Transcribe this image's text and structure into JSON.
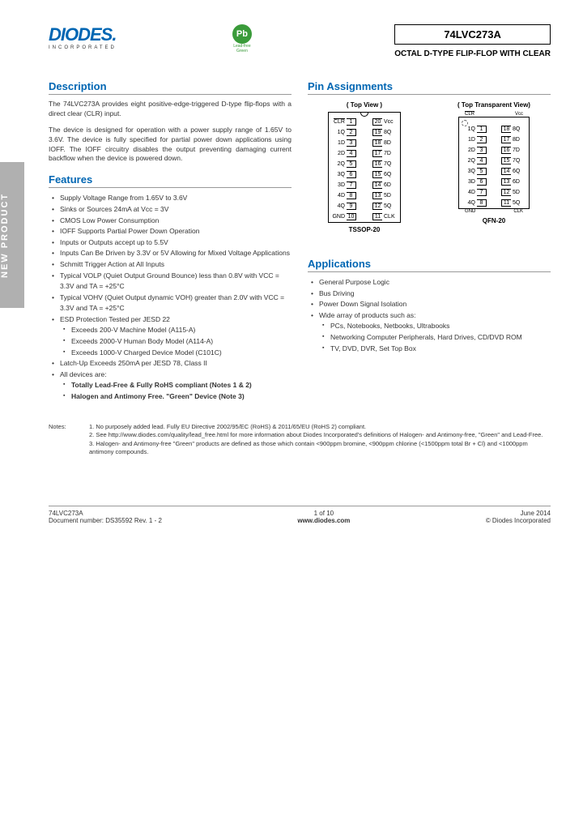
{
  "new_product_label": "NEW PRODUCT",
  "logo": "DIODES",
  "logo_sub": "INCORPORATED",
  "pb_symbol": "Pb",
  "pb_text": "Lead-free Green",
  "part_number": "74LVC273A",
  "subtitle": "OCTAL D-TYPE FLIP-FLOP WITH CLEAR",
  "sections": {
    "description": "Description",
    "features": "Features",
    "pin_assignments": "Pin Assignments",
    "applications": "Applications"
  },
  "description": {
    "p1": "The 74LVC273A provides eight positive-edge-triggered D-type flip-flops with a direct clear (CLR) input.",
    "p2": "The device is designed for operation with a power supply range of 1.65V to 3.6V. The device is fully specified for partial power down applications using IOFF. The IOFF circuitry disables the output preventing damaging current backflow when the device is powered down."
  },
  "features": [
    "Supply Voltage Range from 1.65V to 3.6V",
    "Sinks or Sources 24mA at Vcc = 3V",
    "CMOS Low Power Consumption",
    "IOFF Supports Partial Power Down Operation",
    "Inputs or Outputs accept up to 5.5V",
    "Inputs Can Be Driven by 3.3V or 5V Allowing for Mixed Voltage Applications",
    "Schmitt Trigger Action at All Inputs",
    "Typical VOLP (Quiet Output Ground Bounce) less than 0.8V with VCC = 3.3V and TA = +25°C",
    "Typical VOHV (Quiet Output dynamic VOH) greater than 2.0V with VCC = 3.3V and TA = +25°C",
    "ESD Protection Tested per JESD 22"
  ],
  "features_esd": [
    "Exceeds 200-V Machine Model (A115-A)",
    "Exceeds 2000-V Human Body Model (A114-A)",
    "Exceeds 1000-V Charged Device Model (C101C)"
  ],
  "features_after": [
    "Latch-Up Exceeds 250mA per JESD 78, Class II",
    "All devices are:"
  ],
  "features_compliance": [
    "Totally Lead-Free & Fully RoHS compliant (Notes 1 & 2)",
    "Halogen and Antimony Free. \"Green\" Device (Note 3)"
  ],
  "pin_labels": {
    "top_view": "( Top View )",
    "top_transparent": "( Top Transparent View)",
    "tssop": "TSSOP-20",
    "qfn": "QFN-20"
  },
  "pins_tssop": [
    {
      "l": "CLR",
      "nl": "1",
      "nr": "20",
      "r": "Vcc",
      "over_l": true
    },
    {
      "l": "1Q",
      "nl": "2",
      "nr": "19",
      "r": "8Q"
    },
    {
      "l": "1D",
      "nl": "3",
      "nr": "18",
      "r": "8D"
    },
    {
      "l": "2D",
      "nl": "4",
      "nr": "17",
      "r": "7D"
    },
    {
      "l": "2Q",
      "nl": "5",
      "nr": "16",
      "r": "7Q"
    },
    {
      "l": "3Q",
      "nl": "6",
      "nr": "15",
      "r": "6Q"
    },
    {
      "l": "3D",
      "nl": "7",
      "nr": "14",
      "r": "6D"
    },
    {
      "l": "4D",
      "nl": "8",
      "nr": "13",
      "r": "5D"
    },
    {
      "l": "4Q",
      "nl": "9",
      "nr": "12",
      "r": "5Q"
    },
    {
      "l": "GND",
      "nl": "10",
      "nr": "11",
      "r": "CLK"
    }
  ],
  "pins_qfn": [
    {
      "l": "1Q",
      "nl": "1",
      "nr": "18",
      "r": "8Q"
    },
    {
      "l": "1D",
      "nl": "2",
      "nr": "17",
      "r": "8D"
    },
    {
      "l": "2D",
      "nl": "3",
      "nr": "16",
      "r": "7D"
    },
    {
      "l": "2Q",
      "nl": "4",
      "nr": "15",
      "r": "7Q"
    },
    {
      "l": "3Q",
      "nl": "5",
      "nr": "14",
      "r": "6Q"
    },
    {
      "l": "3D",
      "nl": "6",
      "nr": "13",
      "r": "6D"
    },
    {
      "l": "4D",
      "nl": "7",
      "nr": "12",
      "r": "5D"
    },
    {
      "l": "4Q",
      "nl": "8",
      "nr": "11",
      "r": "5Q"
    }
  ],
  "qfn_top": {
    "l": "CLR",
    "r": "Vcc"
  },
  "qfn_bottom": {
    "l": "GND",
    "r": "CLK"
  },
  "applications": [
    "General Purpose Logic",
    "Bus Driving",
    "Power Down Signal Isolation",
    "Wide array of products such as:"
  ],
  "applications_sub": [
    "PCs, Notebooks, Netbooks, Ultrabooks",
    "Networking Computer Peripherals, Hard Drives, CD/DVD ROM",
    "TV, DVD, DVR, Set Top Box"
  ],
  "notes_label": "Notes:",
  "notes": [
    "1. No purposely added lead. Fully EU Directive 2002/95/EC (RoHS) & 2011/65/EU (RoHS 2) compliant.",
    "2. See http://www.diodes.com/quality/lead_free.html for more information about Diodes Incorporated's definitions of Halogen- and Antimony-free, \"Green\" and Lead-Free.",
    "3. Halogen- and Antimony-free \"Green\" products are defined as those which contain <900ppm bromine, <900ppm chlorine (<1500ppm total Br + Cl) and <1000ppm antimony compounds."
  ],
  "footer": {
    "part": "74LVC273A",
    "doc": "Document number: DS35592 Rev. 1 - 2",
    "page": "1 of 10",
    "url": "www.diodes.com",
    "date": "June 2014",
    "copyright": "© Diodes Incorporated"
  }
}
